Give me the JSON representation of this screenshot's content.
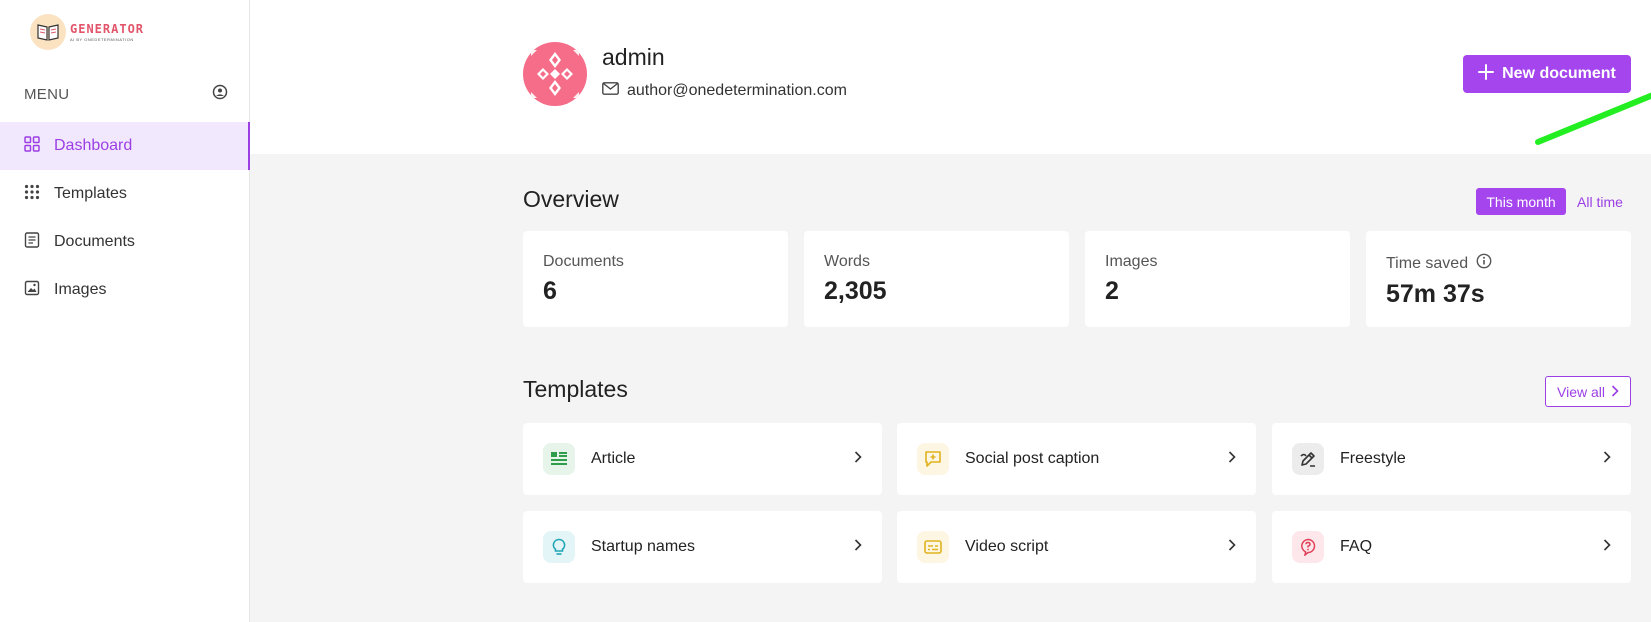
{
  "logo": {
    "title": "GENERATOR",
    "subtitle": "AI BY ONEDETERMINATION"
  },
  "sidebar": {
    "menu_label": "MENU",
    "items": [
      {
        "label": "Dashboard",
        "icon": "grid-icon",
        "active": true
      },
      {
        "label": "Templates",
        "icon": "dots-grid-icon",
        "active": false
      },
      {
        "label": "Documents",
        "icon": "document-icon",
        "active": false
      },
      {
        "label": "Images",
        "icon": "image-icon",
        "active": false
      }
    ]
  },
  "header": {
    "user_name": "admin",
    "user_email": "author@onedetermination.com",
    "new_document_label": "New document"
  },
  "overview": {
    "title": "Overview",
    "toggle_active": "This month",
    "toggle_other": "All time",
    "stats": [
      {
        "label": "Documents",
        "value": "6"
      },
      {
        "label": "Words",
        "value": "2,305"
      },
      {
        "label": "Images",
        "value": "2"
      },
      {
        "label": "Time saved",
        "value": "57m 37s"
      }
    ]
  },
  "templates": {
    "title": "Templates",
    "view_all": "View all",
    "items": [
      {
        "label": "Article",
        "icon": "article-icon",
        "color": "#2e9e4a",
        "bg": "#e6f4ea"
      },
      {
        "label": "Social post caption",
        "icon": "message-plus-icon",
        "color": "#e0b31f",
        "bg": "#fdf6e2"
      },
      {
        "label": "Freestyle",
        "icon": "pen-icon",
        "color": "#333333",
        "bg": "#ececec"
      },
      {
        "label": "Startup names",
        "icon": "lightbulb-icon",
        "color": "#1ea5b5",
        "bg": "#e3f5f7"
      },
      {
        "label": "Video script",
        "icon": "subtitles-icon",
        "color": "#e0b31f",
        "bg": "#fdf6e2"
      },
      {
        "label": "FAQ",
        "icon": "help-bubble-icon",
        "color": "#e0405a",
        "bg": "#fde7ea"
      }
    ]
  },
  "colors": {
    "accent": "#a545ee",
    "annotation_arrow": "#22ee22"
  }
}
